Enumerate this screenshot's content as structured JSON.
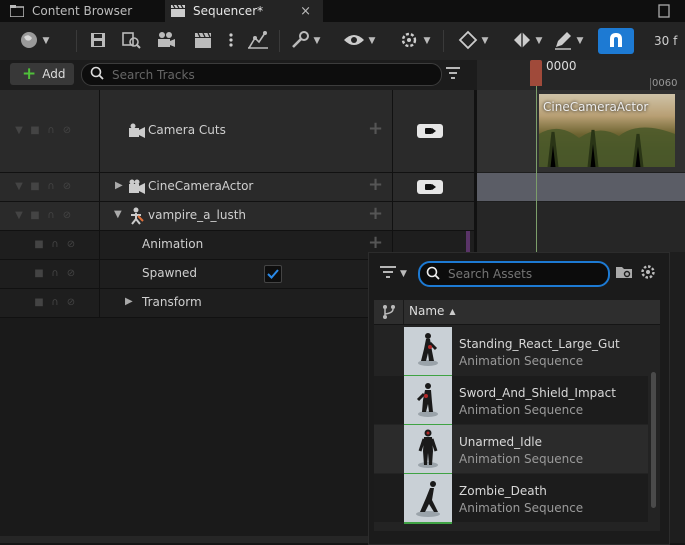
{
  "tabs": [
    {
      "label": "Content Browser"
    },
    {
      "label": "Sequencer*",
      "close": "×"
    }
  ],
  "toolbar": {
    "frame_rate": "30 f"
  },
  "tracks_header": {
    "add_label": "Add",
    "search_placeholder": "Search Tracks"
  },
  "tracks": [
    {
      "label": "Camera Cuts"
    },
    {
      "label": "CineCameraActor"
    },
    {
      "label": "vampire_a_lusth"
    },
    {
      "label": "Animation"
    },
    {
      "label": "Spawned",
      "checked": true
    },
    {
      "label": "Transform"
    }
  ],
  "timeline": {
    "current_frame": "0000",
    "tick_label": "0060",
    "clip_label": "CineCameraActor"
  },
  "asset_picker": {
    "search_placeholder": "Search Assets",
    "column_name": "Name",
    "items": [
      {
        "name": "Standing_React_Large_Gut",
        "type": "Animation Sequence"
      },
      {
        "name": "Sword_And_Shield_Impact",
        "type": "Animation Sequence"
      },
      {
        "name": "Unarmed_Idle",
        "type": "Animation Sequence"
      },
      {
        "name": "Zombie_Death",
        "type": "Animation Sequence"
      }
    ]
  },
  "colors": {
    "accent_blue": "#1d7ad3",
    "add_plus_green": "#4fbf3a",
    "playhead": "#a04a3a",
    "thumb_underline": "#3fa344"
  },
  "icons": [
    "content-browser-icon",
    "sequencer-icon",
    "world-icon",
    "save-icon",
    "find-asset-icon",
    "render-movie-icon",
    "clapper-icon",
    "more-icon",
    "curve-icon",
    "wrench-icon",
    "eye-icon",
    "gear-snap-icon",
    "key-icon",
    "keyframe-icon",
    "pen-icon",
    "snap-magnet-icon",
    "filter-icon",
    "folder-icon",
    "settings-icon",
    "sort-asc-icon",
    "lock-icon",
    "pin-icon",
    "headphone-icon",
    "mute-icon",
    "expand-arrow-icon"
  ]
}
